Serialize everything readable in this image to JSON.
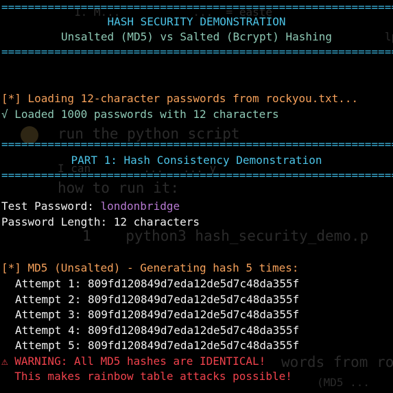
{
  "colors": {
    "background": "#000000",
    "separator": "#3ab0d8",
    "heading": "#4cc3e6",
    "success": "#8ec9b5",
    "info": "#f5a05a",
    "value": "#b679d1",
    "warning": "#f0424c",
    "text": "#f2f2f2"
  },
  "background_overlay": {
    "l1": "1. M...           ...  = easte",
    "l2": "                         lp",
    "l3": "run the python script",
    "l4": "I can        ...   ... y",
    "l5": "how to run it:",
    "l6": "1    python3 hash_security_demo.p",
    "l7": "words from ro",
    "l8": "(MD5 ..."
  },
  "terminal": {
    "separator": "============================================================",
    "banner": {
      "title": "HASH SECURITY DEMONSTRATION",
      "subtitle": "Unsalted (MD5) vs Salted (Bcrypt) Hashing"
    },
    "loading": "[*] Loading 12-character passwords from rockyou.txt...",
    "loaded": "√ Loaded 1000 passwords with 12 characters",
    "part1_title": "PART 1: Hash Consistency Demonstration",
    "test_password_label": "Test Password: ",
    "test_password_value": "londonbridge",
    "password_length": "Password Length: 12 characters",
    "md5_header": "[*] MD5 (Unsalted) - Generating hash 5 times:",
    "attempts": [
      "Attempt 1: 809fd120849d7eda12de5d7c48da355f",
      "Attempt 2: 809fd120849d7eda12de5d7c48da355f",
      "Attempt 3: 809fd120849d7eda12de5d7c48da355f",
      "Attempt 4: 809fd120849d7eda12de5d7c48da355f",
      "Attempt 5: 809fd120849d7eda12de5d7c48da355f"
    ],
    "warning": "⚠ WARNING: All MD5 hashes are IDENTICAL!",
    "warning_detail": "  This makes rainbow table attacks possible!"
  }
}
